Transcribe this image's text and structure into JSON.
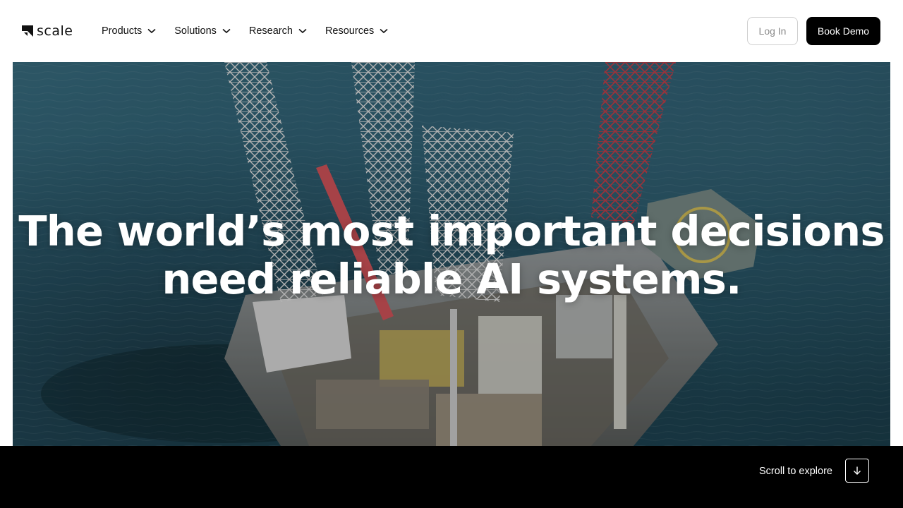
{
  "brand": {
    "name": "scale",
    "logo_icon": "scale-logo-mark-icon"
  },
  "nav": {
    "items": [
      {
        "label": "Products",
        "icon": "chevron-down-icon"
      },
      {
        "label": "Solutions",
        "icon": "chevron-down-icon"
      },
      {
        "label": "Research",
        "icon": "chevron-down-icon"
      },
      {
        "label": "Resources",
        "icon": "chevron-down-icon"
      }
    ]
  },
  "header": {
    "login_label": "Log In",
    "demo_label": "Book Demo"
  },
  "hero": {
    "headline_line1": "The world’s most important decisions",
    "headline_line2": "need reliable AI systems.",
    "background": "offshore-oil-rig-aerial-image"
  },
  "footer": {
    "scroll_label": "Scroll to explore",
    "scroll_icon": "arrow-down-icon"
  },
  "colors": {
    "primary_button_bg": "#000000",
    "primary_button_text": "#ffffff",
    "secondary_button_border": "#cfcfcf",
    "bottom_bar_bg": "#000000"
  }
}
